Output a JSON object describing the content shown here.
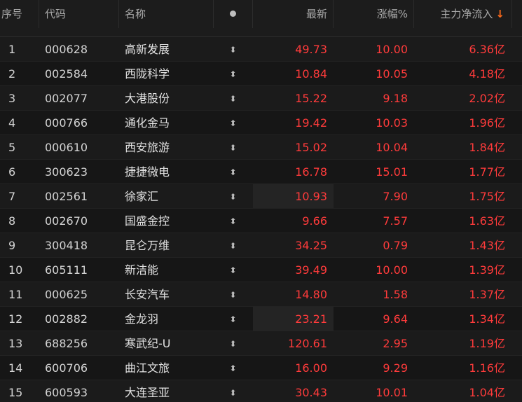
{
  "header": {
    "idx": "序号",
    "code": "代码",
    "name": "名称",
    "price": "最新",
    "change": "涨幅%",
    "flow": "主力净流入",
    "sort_arrow": "↓",
    "dot_icon": "circle-dot-icon"
  },
  "colors": {
    "up": "#ff3b3b",
    "sort_arrow": "#ff6a1a",
    "background": "#171717"
  },
  "rows": [
    {
      "idx": "1",
      "code": "000628",
      "name": "高新发展",
      "action": "⬍",
      "price": "49.73",
      "change": "10.00",
      "flow": "6.36亿"
    },
    {
      "idx": "2",
      "code": "002584",
      "name": "西陇科学",
      "action": "⬍",
      "price": "10.84",
      "change": "10.05",
      "flow": "4.18亿"
    },
    {
      "idx": "3",
      "code": "002077",
      "name": "大港股份",
      "action": "⬍",
      "price": "15.22",
      "change": "9.18",
      "flow": "2.02亿"
    },
    {
      "idx": "4",
      "code": "000766",
      "name": "通化金马",
      "action": "⬍",
      "price": "19.42",
      "change": "10.03",
      "flow": "1.96亿"
    },
    {
      "idx": "5",
      "code": "000610",
      "name": "西安旅游",
      "action": "⬍",
      "price": "15.02",
      "change": "10.04",
      "flow": "1.84亿"
    },
    {
      "idx": "6",
      "code": "300623",
      "name": "捷捷微电",
      "action": "⬍",
      "price": "16.78",
      "change": "15.01",
      "flow": "1.77亿"
    },
    {
      "idx": "7",
      "code": "002561",
      "name": "徐家汇",
      "action": "⬍",
      "price": "10.93",
      "change": "7.90",
      "flow": "1.75亿"
    },
    {
      "idx": "8",
      "code": "002670",
      "name": "国盛金控",
      "action": "⬍",
      "price": "9.66",
      "change": "7.57",
      "flow": "1.63亿"
    },
    {
      "idx": "9",
      "code": "300418",
      "name": "昆仑万维",
      "action": "⬍",
      "price": "34.25",
      "change": "0.79",
      "flow": "1.43亿"
    },
    {
      "idx": "10",
      "code": "605111",
      "name": "新洁能",
      "action": "⬍",
      "price": "39.49",
      "change": "10.00",
      "flow": "1.39亿"
    },
    {
      "idx": "11",
      "code": "000625",
      "name": "长安汽车",
      "action": "⬍",
      "price": "14.80",
      "change": "1.58",
      "flow": "1.37亿"
    },
    {
      "idx": "12",
      "code": "002882",
      "name": "金龙羽",
      "action": "⬍",
      "price": "23.21",
      "change": "9.64",
      "flow": "1.34亿"
    },
    {
      "idx": "13",
      "code": "688256",
      "name": "寒武纪-U",
      "action": "⬍",
      "price": "120.61",
      "change": "2.95",
      "flow": "1.19亿"
    },
    {
      "idx": "14",
      "code": "600706",
      "name": "曲江文旅",
      "action": "⬍",
      "price": "16.00",
      "change": "9.29",
      "flow": "1.16亿"
    },
    {
      "idx": "15",
      "code": "600593",
      "name": "大连圣亚",
      "action": "⬍",
      "price": "30.43",
      "change": "10.01",
      "flow": "1.04亿"
    }
  ]
}
